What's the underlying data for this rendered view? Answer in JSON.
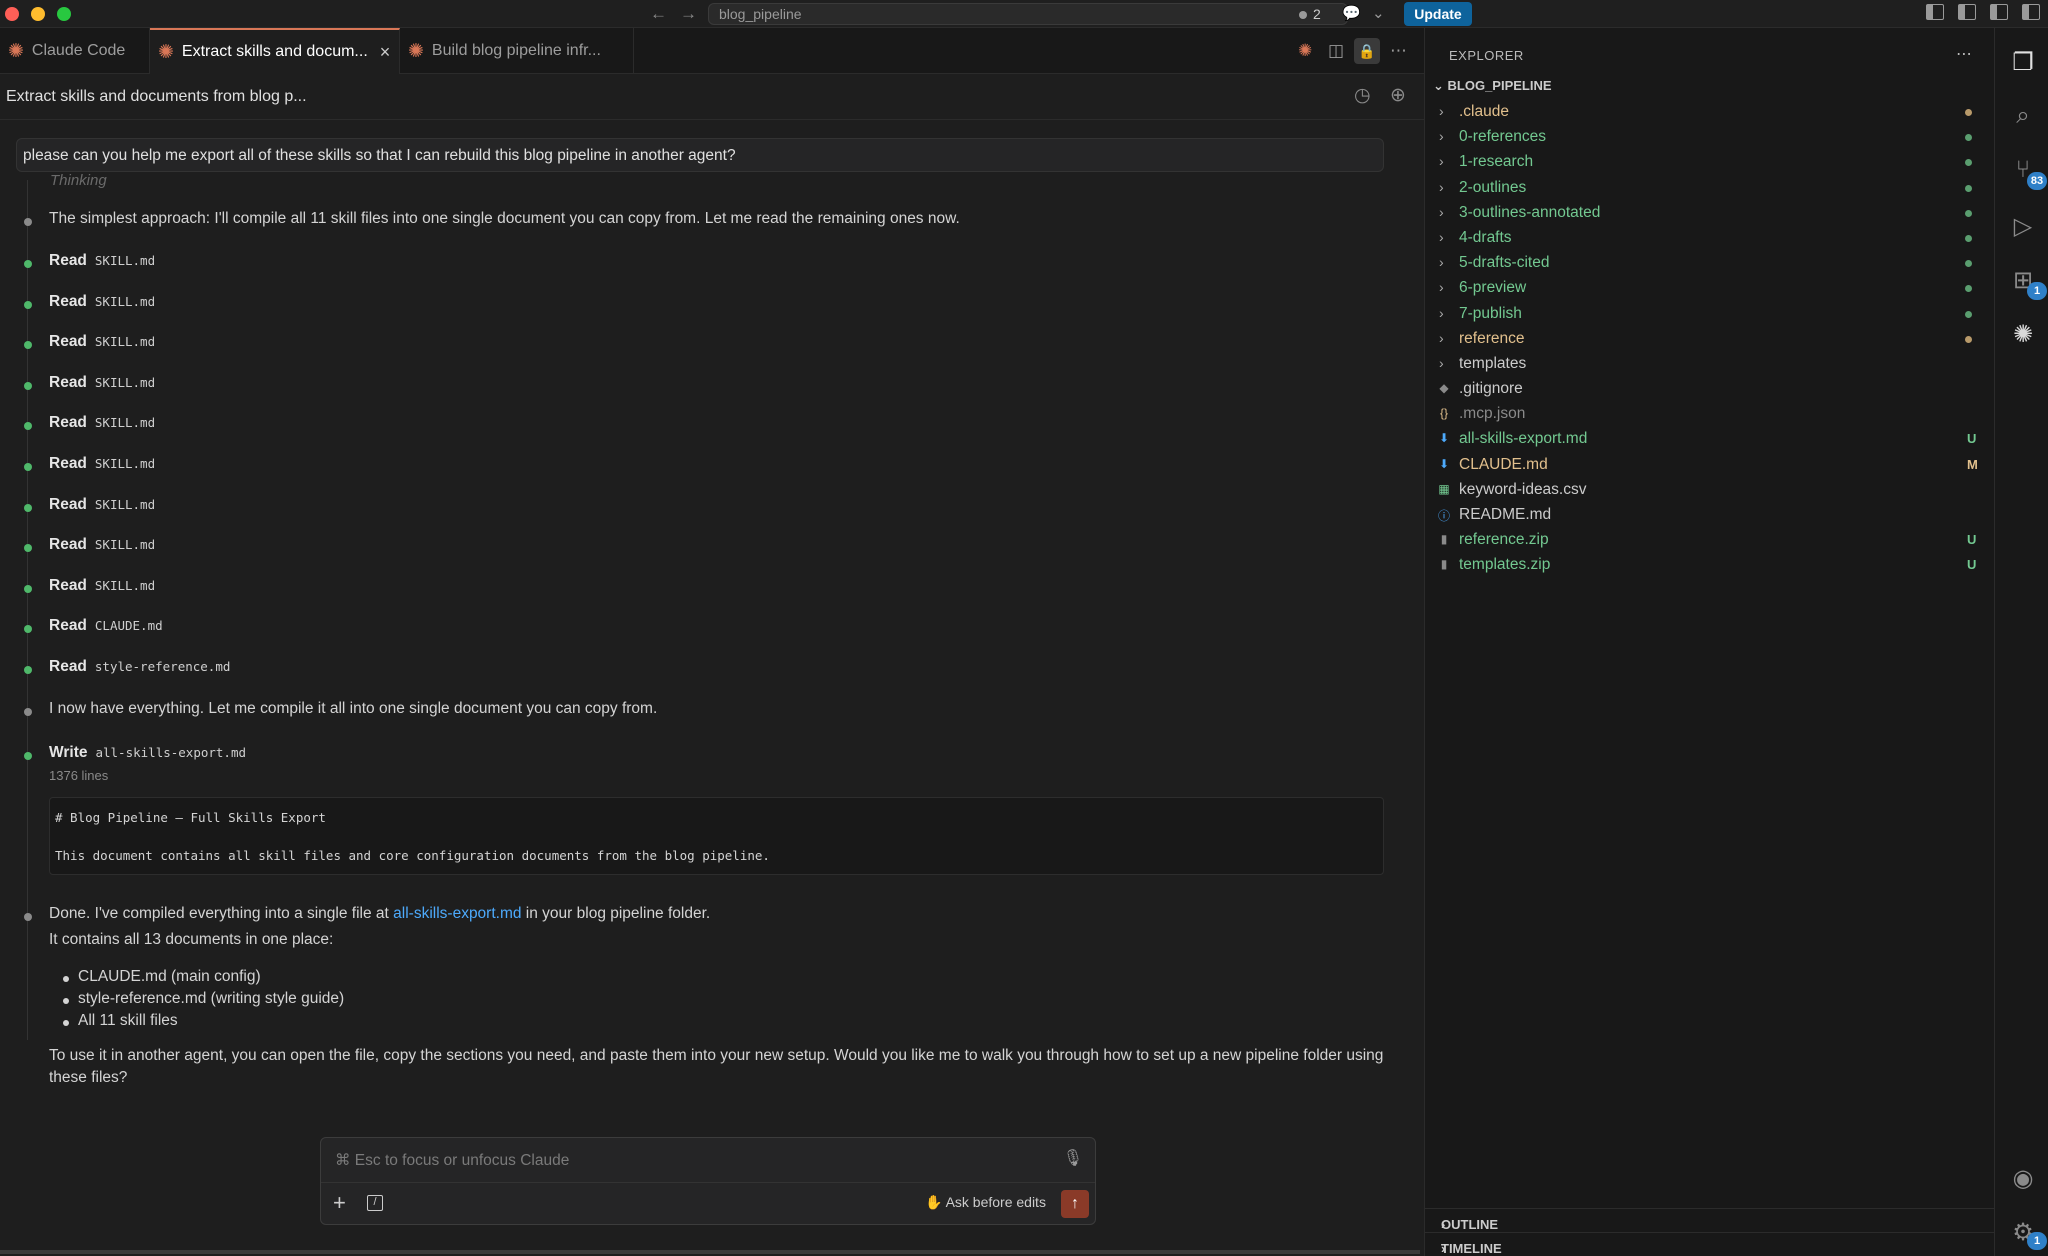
{
  "titlebar": {
    "search_text": "blog_pipeline",
    "notification_count": "2",
    "update_label": "Update"
  },
  "tabs": [
    {
      "label": "Claude Code",
      "active": false
    },
    {
      "label": "Extract skills and docum...",
      "active": true
    },
    {
      "label": "Build blog pipeline infr...",
      "active": false
    }
  ],
  "conversation": {
    "title": "Extract skills and documents from blog p...",
    "user_message": "please can you help me export all of these skills so that I can rebuild this blog pipeline in another agent?",
    "thinking_label": "Thinking",
    "intro": "The simplest approach: I'll compile all 11 skill files into one single document you can copy from. Let me read the remaining ones now.",
    "reads": [
      {
        "verb": "Read",
        "file": "SKILL.md"
      },
      {
        "verb": "Read",
        "file": "SKILL.md"
      },
      {
        "verb": "Read",
        "file": "SKILL.md"
      },
      {
        "verb": "Read",
        "file": "SKILL.md"
      },
      {
        "verb": "Read",
        "file": "SKILL.md"
      },
      {
        "verb": "Read",
        "file": "SKILL.md"
      },
      {
        "verb": "Read",
        "file": "SKILL.md"
      },
      {
        "verb": "Read",
        "file": "SKILL.md"
      },
      {
        "verb": "Read",
        "file": "SKILL.md"
      },
      {
        "verb": "Read",
        "file": "CLAUDE.md"
      },
      {
        "verb": "Read",
        "file": "style-reference.md"
      }
    ],
    "compile_msg": "I now have everything. Let me compile it all into one single document you can copy from.",
    "write": {
      "verb": "Write",
      "file": "all-skills-export.md",
      "lines": "1376 lines",
      "code": [
        "# Blog Pipeline — Full Skills Export",
        "This document contains all skill files and core configuration documents from the blog pipeline."
      ]
    },
    "done": {
      "prefix": "Done. I've compiled everything into a single file at ",
      "link": "all-skills-export.md",
      "suffix": " in your blog pipeline folder.",
      "contains": "It contains all 13 documents in one place:",
      "bullets": [
        "CLAUDE.md (main config)",
        "style-reference.md (writing style guide)",
        "All 11 skill files"
      ],
      "closing": "To use it in another agent, you can open the file, copy the sections you need, and paste them into your new setup. Would you like me to walk you through how to set up a new pipeline folder using these files?"
    }
  },
  "input": {
    "placeholder": "⌘ Esc to focus or unfocus Claude",
    "ask_label": "Ask before edits"
  },
  "explorer": {
    "title": "EXPLORER",
    "root": "BLOG_PIPELINE",
    "items": [
      {
        "label": ".claude",
        "kind": "folder",
        "color": "#e2c08d",
        "dot": "#b89a6a"
      },
      {
        "label": "0-references",
        "kind": "folder",
        "color": "#73c991",
        "dot": "#5a9e6f"
      },
      {
        "label": "1-research",
        "kind": "folder",
        "color": "#73c991",
        "dot": "#5a9e6f"
      },
      {
        "label": "2-outlines",
        "kind": "folder",
        "color": "#73c991",
        "dot": "#5a9e6f"
      },
      {
        "label": "3-outlines-annotated",
        "kind": "folder",
        "color": "#73c991",
        "dot": "#5a9e6f"
      },
      {
        "label": "4-drafts",
        "kind": "folder",
        "color": "#73c991",
        "dot": "#5a9e6f"
      },
      {
        "label": "5-drafts-cited",
        "kind": "folder",
        "color": "#73c991",
        "dot": "#5a9e6f"
      },
      {
        "label": "6-preview",
        "kind": "folder",
        "color": "#73c991",
        "dot": "#5a9e6f"
      },
      {
        "label": "7-publish",
        "kind": "folder",
        "color": "#73c991",
        "dot": "#5a9e6f"
      },
      {
        "label": "reference",
        "kind": "folder",
        "color": "#e2c08d",
        "dot": "#b89a6a"
      },
      {
        "label": "templates",
        "kind": "folder",
        "color": "#cccccc",
        "dot": ""
      },
      {
        "label": ".gitignore",
        "kind": "file",
        "icon": "◆",
        "icon_color": "#8a8a8a",
        "color": "#cccccc",
        "status": ""
      },
      {
        "label": ".mcp.json",
        "kind": "file",
        "icon": "{}",
        "icon_color": "#e2c08d",
        "color": "#8a8a8a",
        "status": ""
      },
      {
        "label": "all-skills-export.md",
        "kind": "file",
        "icon": "⬇",
        "icon_color": "#4daafc",
        "color": "#73c991",
        "status": "U",
        "status_color": "#73c991"
      },
      {
        "label": "CLAUDE.md",
        "kind": "file",
        "icon": "⬇",
        "icon_color": "#4daafc",
        "color": "#e2c08d",
        "status": "M",
        "status_color": "#e2c08d"
      },
      {
        "label": "keyword-ideas.csv",
        "kind": "file",
        "icon": "▦",
        "icon_color": "#73c991",
        "color": "#cccccc",
        "status": ""
      },
      {
        "label": "README.md",
        "kind": "file",
        "icon": "ⓘ",
        "icon_color": "#4daafc",
        "color": "#cccccc",
        "status": ""
      },
      {
        "label": "reference.zip",
        "kind": "file",
        "icon": "▮",
        "icon_color": "#8a8a8a",
        "color": "#73c991",
        "status": "U",
        "status_color": "#73c991"
      },
      {
        "label": "templates.zip",
        "kind": "file",
        "icon": "▮",
        "icon_color": "#8a8a8a",
        "color": "#73c991",
        "status": "U",
        "status_color": "#73c991"
      }
    ],
    "outline_label": "OUTLINE",
    "timeline_label": "TIMELINE"
  },
  "activity_bar": {
    "scm_badge": "83",
    "extensions_badge": "1",
    "settings_badge": "1"
  },
  "colors": {
    "accent": "#d97757",
    "link": "#4daafc",
    "success_dot": "#4fb86a",
    "update_button": "#0e639c"
  }
}
